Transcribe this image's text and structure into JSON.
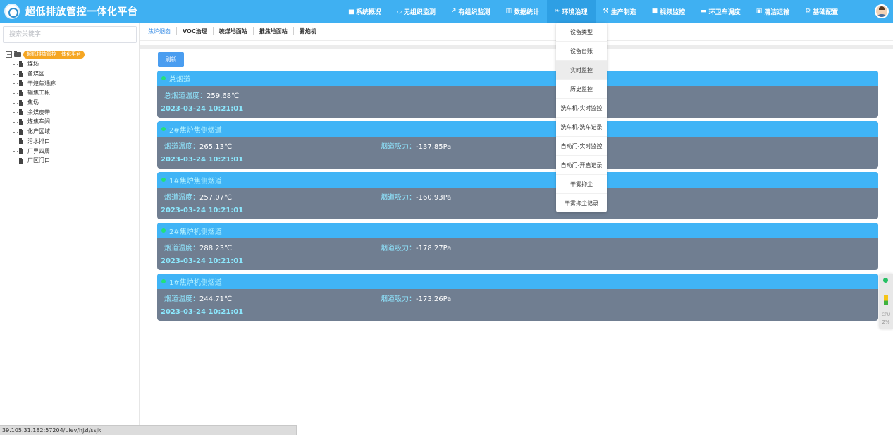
{
  "header": {
    "title": "超低排放管控一体化平台",
    "nav": [
      {
        "label": "系统概况",
        "icon": "map-icon",
        "glyph": "▅"
      },
      {
        "label": "无组织监测",
        "icon": "shield-icon",
        "glyph": "◡"
      },
      {
        "label": "有组织监测",
        "icon": "wand-icon",
        "glyph": "↗"
      },
      {
        "label": "数据统计",
        "icon": "bar-chart-icon",
        "glyph": "▥"
      },
      {
        "label": "环境治理",
        "icon": "leaf-icon",
        "glyph": "❧"
      },
      {
        "label": "生产制造",
        "icon": "wrench-icon",
        "glyph": "⚒"
      },
      {
        "label": "视频监控",
        "icon": "video-icon",
        "glyph": "■"
      },
      {
        "label": "环卫车调度",
        "icon": "truck-icon",
        "glyph": "▬"
      },
      {
        "label": "清洁运输",
        "icon": "bus-icon",
        "glyph": "▣"
      },
      {
        "label": "基础配置",
        "icon": "gears-icon",
        "glyph": "⚙"
      }
    ],
    "active_nav": "环境治理"
  },
  "sidebar": {
    "search_placeholder": "搜索关键字",
    "tree_root": "超低排放管控一体化平台",
    "tree_items": [
      "煤场",
      "备煤区",
      "干熄焦通廊",
      "输焦工段",
      "焦场",
      "余煤皮带",
      "炼焦车间",
      "化产区域",
      "污水排口",
      "厂界四周",
      "厂区门口"
    ]
  },
  "subtabs": [
    "焦炉烟囱",
    "VOC治理",
    "装煤地面站",
    "推焦地面站",
    "雾炮机"
  ],
  "active_subtab": "焦炉烟囱",
  "refresh_label": "刷新",
  "cards": [
    {
      "title": "总烟道",
      "metrics": [
        {
          "label": "总烟道温度：",
          "value": "259.68℃"
        }
      ],
      "time": "2023-03-24 10:21:01"
    },
    {
      "title": "2#焦炉焦侧烟道",
      "metrics": [
        {
          "label": "烟道温度：",
          "value": "265.13℃"
        },
        {
          "label": "烟道吸力：",
          "value": "-137.85Pa"
        }
      ],
      "time": "2023-03-24 10:21:01"
    },
    {
      "title": "1#焦炉焦侧烟道",
      "metrics": [
        {
          "label": "烟道温度：",
          "value": "257.07℃"
        },
        {
          "label": "烟道吸力：",
          "value": "-160.93Pa"
        }
      ],
      "time": "2023-03-24 10:21:01"
    },
    {
      "title": "2#焦炉机侧烟道",
      "metrics": [
        {
          "label": "烟道温度：",
          "value": "288.23℃"
        },
        {
          "label": "烟道吸力：",
          "value": "-178.27Pa"
        }
      ],
      "time": "2023-03-24 10:21:01"
    },
    {
      "title": "1#焦炉机侧烟道",
      "metrics": [
        {
          "label": "烟道温度：",
          "value": "244.71℃"
        },
        {
          "label": "烟道吸力：",
          "value": "-173.26Pa"
        }
      ],
      "time": "2023-03-24 10:21:01"
    }
  ],
  "dropdown": {
    "items": [
      "设备类型",
      "设备台账",
      "实时监控",
      "历史监控",
      "洗车机-实时监控",
      "洗车机-洗车记录",
      "自动门-实时监控",
      "自动门-开启记录",
      "干雾抑尘",
      "干雾抑尘记录"
    ],
    "hovered": "实时监控"
  },
  "float_widget": {
    "label": "CPU",
    "value": "2%"
  },
  "statusbar": {
    "url": "39.105.31.182:57204/ulev/hjzl/ssjk"
  },
  "colors": {
    "header": "#3fb0f2",
    "card_header": "#40b4f6",
    "card_body": "#707e91",
    "status_dot": "#22e07a",
    "root_badge": "#f5a623"
  }
}
